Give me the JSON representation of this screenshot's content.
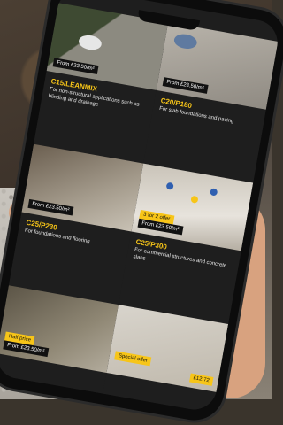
{
  "cards": [
    {
      "price": "From £23.50/m²",
      "title": "C15/LEANMIX",
      "desc": "For non-structural applications such as blinding and drainage",
      "badge": ""
    },
    {
      "price": "From £23.50/m²",
      "title": "C20/P180",
      "desc": "For slab foundations and paving",
      "badge": ""
    },
    {
      "price": "From £23.50/m²",
      "title": "C25/P230",
      "desc": "For foundations and flooring",
      "badge": ""
    },
    {
      "price": "From £23.50/m²",
      "title": "C25/P300",
      "desc": "For commercial structures and concrete slabs",
      "badge": "3 for 2 offer"
    },
    {
      "price": "From £23.50/m²",
      "title": "",
      "desc": "",
      "badge": "Half price"
    },
    {
      "price": "£12.72",
      "title": "",
      "desc": "",
      "badge": "Special offer"
    }
  ],
  "colors": {
    "accent": "#f7c518",
    "card_bg": "#1e1e1e"
  }
}
